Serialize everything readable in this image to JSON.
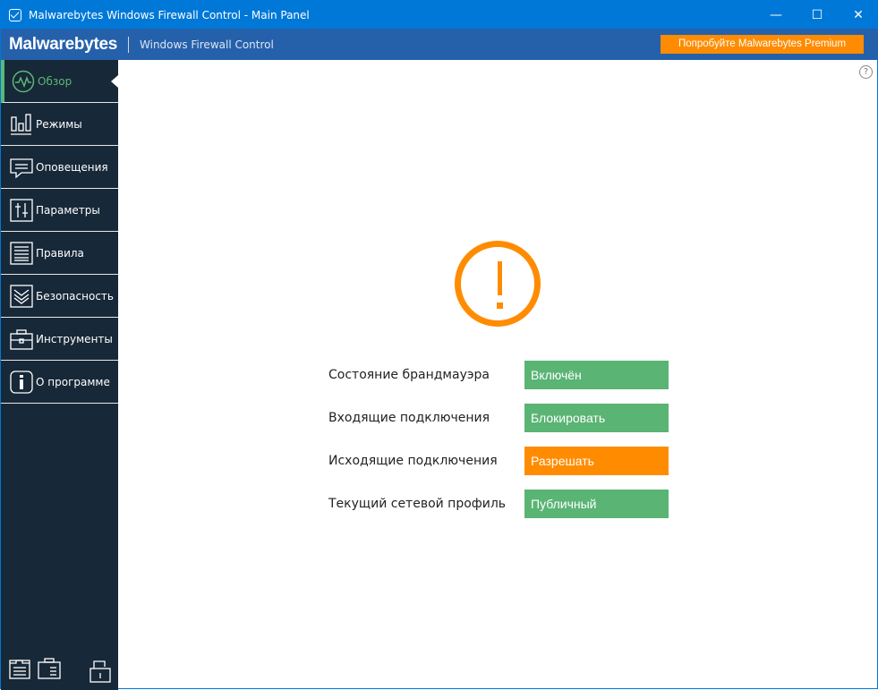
{
  "window": {
    "title": "Malwarebytes Windows Firewall Control - Main Panel",
    "minimize": "—",
    "maximize": "☐",
    "close": "✕"
  },
  "brand": {
    "logo": "Malwarebytes",
    "product": "Windows Firewall Control",
    "premium_button": "Попробуйте Malwarebytes Premium"
  },
  "sidebar": {
    "items": [
      {
        "label": "Обзор",
        "icon": "pulse-icon",
        "active": true
      },
      {
        "label": "Режимы",
        "icon": "bars-icon"
      },
      {
        "label": "Оповещения",
        "icon": "message-icon"
      },
      {
        "label": "Параметры",
        "icon": "sliders-icon"
      },
      {
        "label": "Правила",
        "icon": "list-icon"
      },
      {
        "label": "Безопасность",
        "icon": "shield-icon"
      },
      {
        "label": "Инструменты",
        "icon": "toolbox-icon"
      },
      {
        "label": "О программе",
        "icon": "info-icon"
      }
    ]
  },
  "help": "?",
  "status": {
    "rows": [
      {
        "label": "Состояние брандмауэра",
        "value": "Включён",
        "color": "#5ab473"
      },
      {
        "label": "Входящие подключения",
        "value": "Блокировать",
        "color": "#5ab473"
      },
      {
        "label": "Исходящие подключения",
        "value": "Разрешать",
        "color": "#ff8c00"
      },
      {
        "label": "Текущий сетевой профиль",
        "value": "Публичный",
        "color": "#5ab473"
      }
    ]
  }
}
